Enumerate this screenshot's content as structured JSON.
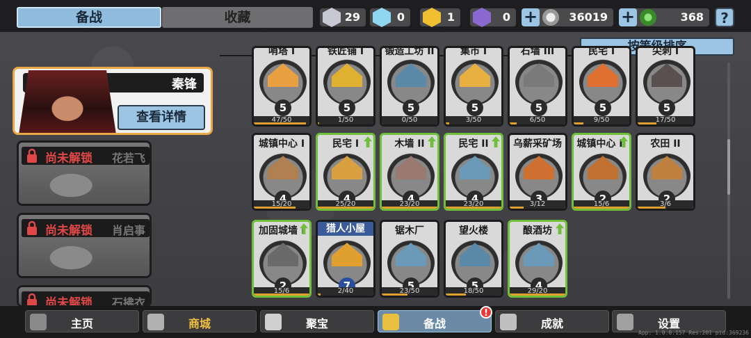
{
  "tabs": [
    {
      "label": "备战",
      "active": true
    },
    {
      "label": "收藏",
      "active": false
    }
  ],
  "resources": [
    {
      "name": "silver-shard",
      "value": "29",
      "color": "#c8c8d4"
    },
    {
      "name": "crystal-shard",
      "value": "0",
      "color": "#8fd6f0"
    },
    {
      "name": "gold-shard",
      "value": "1",
      "color": "#f0c030"
    },
    {
      "name": "purple-shard",
      "value": "0",
      "color": "#8a6ad0"
    }
  ],
  "currency": [
    {
      "name": "silver-coin",
      "value": "36019",
      "color": "#bcbcbc"
    },
    {
      "name": "green-gem",
      "value": "368",
      "color": "#4aaa3a"
    }
  ],
  "help_label": "?",
  "hero": {
    "name": "秦锋",
    "detail_label": "查看详情"
  },
  "locked_heroes": [
    {
      "status": "尚未解锁",
      "name": "花若飞"
    },
    {
      "status": "尚未解锁",
      "name": "肖启事"
    },
    {
      "status": "尚未解锁",
      "name": "石拂衣"
    }
  ],
  "sort_label": "按等级排序",
  "buildings_row0": [
    {
      "title": "哨塔 I",
      "level": "5",
      "progress": "47/50",
      "fill": 0.94,
      "color": "#e8a040"
    },
    {
      "title": "铁匠铺 I",
      "level": "5",
      "progress": "1/50",
      "fill": 0.02,
      "color": "#e0b030"
    },
    {
      "title": "锻造工坊 II",
      "level": "5",
      "progress": "0/50",
      "fill": 0.0,
      "color": "#5a8aa8"
    },
    {
      "title": "集市 I",
      "level": "5",
      "progress": "3/50",
      "fill": 0.06,
      "color": "#e8b040"
    },
    {
      "title": "石墙 III",
      "level": "5",
      "progress": "6/50",
      "fill": 0.12,
      "color": "#7a7a7a"
    },
    {
      "title": "民宅 I",
      "level": "5",
      "progress": "9/50",
      "fill": 0.18,
      "color": "#e07030"
    },
    {
      "title": "尖刺 I",
      "level": "5",
      "progress": "17/50",
      "fill": 0.34,
      "color": "#5a5050"
    }
  ],
  "buildings_row1": [
    {
      "title": "城镇中心 I",
      "level": "4",
      "progress": "15/20",
      "fill": 0.75,
      "color": "#b08050",
      "upgrade": false
    },
    {
      "title": "民宅 I",
      "level": "4",
      "progress": "25/20",
      "fill": 1.0,
      "color": "#d8a040",
      "upgrade": true
    },
    {
      "title": "木墙 II",
      "level": "4",
      "progress": "23/20",
      "fill": 1.0,
      "color": "#9a7a70",
      "upgrade": true
    },
    {
      "title": "民宅 II",
      "level": "4",
      "progress": "23/20",
      "fill": 1.0,
      "color": "#6a9ab8",
      "upgrade": true
    },
    {
      "title": "乌薪采矿场",
      "level": "3",
      "progress": "3/12",
      "fill": 0.25,
      "color": "#d07030",
      "upgrade": false
    },
    {
      "title": "城镇中心 II",
      "level": "2",
      "progress": "15/6",
      "fill": 1.0,
      "color": "#c07030",
      "upgrade": true
    },
    {
      "title": "农田 II",
      "level": "2",
      "progress": "3/6",
      "fill": 0.5,
      "color": "#c08040",
      "upgrade": false
    }
  ],
  "buildings_row2": [
    {
      "title": "加固城墙 I",
      "level": "2",
      "progress": "15/6",
      "fill": 1.0,
      "color": "#6a6a6a",
      "upgrade": true
    },
    {
      "title": "猎人小屋",
      "level": "7",
      "progress": "2/40",
      "fill": 0.05,
      "color": "#e0a030",
      "upgrade": false,
      "band": true
    },
    {
      "title": "锯木厂",
      "level": "5",
      "progress": "23/50",
      "fill": 0.46,
      "color": "#6a9ab8",
      "upgrade": false
    },
    {
      "title": "望火楼",
      "level": "5",
      "progress": "18/50",
      "fill": 0.36,
      "color": "#5a8aa8",
      "upgrade": false
    },
    {
      "title": "酿酒坊",
      "level": "4",
      "progress": "29/20",
      "fill": 1.0,
      "color": "#6a9ab8",
      "upgrade": true
    }
  ],
  "nav": [
    {
      "label": "主页",
      "icon": "home-icon",
      "active": false
    },
    {
      "label": "商城",
      "icon": "shop-icon",
      "active": false
    },
    {
      "label": "聚宝",
      "icon": "treasure-icon",
      "active": false
    },
    {
      "label": "备战",
      "icon": "prepare-icon",
      "active": true
    },
    {
      "label": "成就",
      "icon": "achievement-icon",
      "active": false
    },
    {
      "label": "设置",
      "icon": "gear-icon",
      "active": false
    }
  ],
  "nav_badge": "!",
  "version": "App: 1.0.0.157 Res:201 pid:369236"
}
